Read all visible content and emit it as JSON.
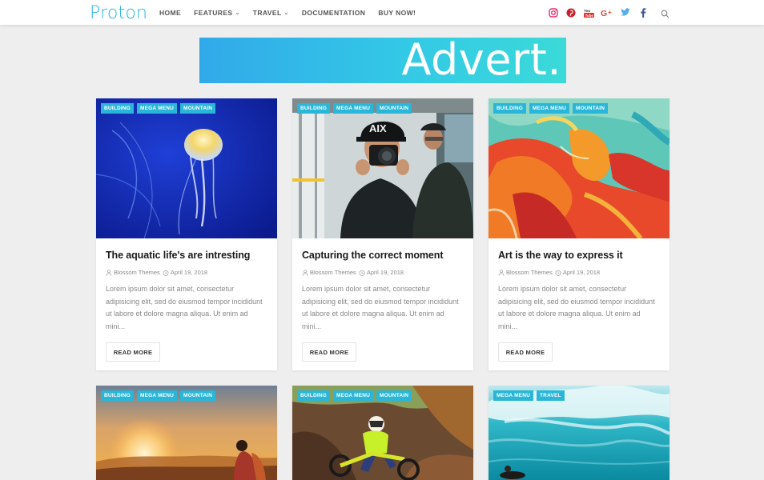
{
  "header": {
    "logo": "Proton",
    "nav": [
      {
        "label": "HOME",
        "dropdown": false
      },
      {
        "label": "FEATURES",
        "dropdown": true
      },
      {
        "label": "TRAVEL",
        "dropdown": true
      },
      {
        "label": "DOCUMENTATION",
        "dropdown": false
      },
      {
        "label": "BUY NOW!",
        "dropdown": false
      }
    ],
    "social": [
      {
        "name": "instagram-icon",
        "color": "#e1306c"
      },
      {
        "name": "pinterest-icon",
        "color": "#cb2027"
      },
      {
        "name": "youtube-icon",
        "color": "#e52d27"
      },
      {
        "name": "google-plus-icon",
        "color": "#dd4b39"
      },
      {
        "name": "twitter-icon",
        "color": "#55acee"
      },
      {
        "name": "facebook-icon",
        "color": "#3b5998"
      }
    ]
  },
  "advert": {
    "text": "Advert."
  },
  "cards": [
    {
      "tags": [
        "BUILDING",
        "MEGA MENU",
        "MOUNTAIN"
      ],
      "title": "The aquatic life's are intresting",
      "author": "Blossom Themes",
      "date": "April 19, 2018",
      "excerpt": "Lorem ipsum dolor sit amet, consectetur adipisicing elit, sed do eiusmod tempor incididunt ut labore et dolore magna aliqua. Ut enim ad mini...",
      "read_more": "READ MORE",
      "image": "jellyfish"
    },
    {
      "tags": [
        "BUILDING",
        "MEGA MENU",
        "MOUNTAIN"
      ],
      "title": "Capturing the correct moment",
      "author": "Blossom Themes",
      "date": "April 19, 2018",
      "excerpt": "Lorem ipsum dolor sit amet, consectetur adipisicing elit, sed do eiusmod tempor incididunt ut labore et dolore magna aliqua. Ut enim ad mini...",
      "read_more": "READ MORE",
      "image": "photographer"
    },
    {
      "tags": [
        "BUILDING",
        "MEGA MENU",
        "MOUNTAIN"
      ],
      "title": "Art is the way to express it",
      "author": "Blossom Themes",
      "date": "April 19, 2018",
      "excerpt": "Lorem ipsum dolor sit amet, consectetur adipisicing elit, sed do eiusmod tempor incididunt ut labore et dolore magna aliqua. Ut enim ad mini...",
      "read_more": "READ MORE",
      "image": "abstract-painting"
    },
    {
      "tags": [
        "BUILDING",
        "MEGA MENU",
        "MOUNTAIN"
      ],
      "image": "sunset-hiker"
    },
    {
      "tags": [
        "BUILDING",
        "MEGA MENU",
        "MOUNTAIN"
      ],
      "image": "motocross"
    },
    {
      "tags": [
        "MEGA MENU",
        "TRAVEL"
      ],
      "image": "ocean-wave"
    }
  ]
}
